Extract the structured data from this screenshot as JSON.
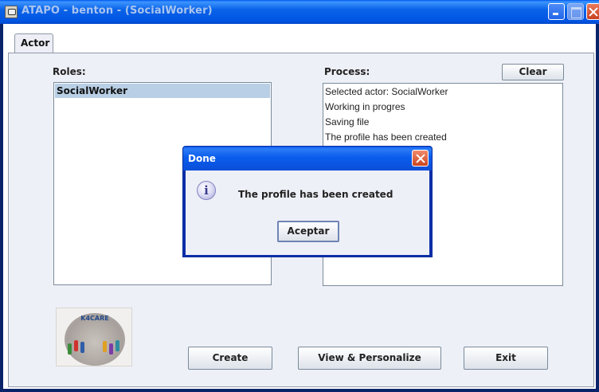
{
  "window": {
    "title": "ATAPO - benton - (SocialWorker)",
    "icon": "app-window-icon",
    "controls": [
      "minimize-icon",
      "maximize-icon",
      "close-icon"
    ]
  },
  "tabs": [
    {
      "label": "Actor",
      "selected": true
    }
  ],
  "roles": {
    "label": "Roles:",
    "items": [
      "SocialWorker"
    ],
    "selected_index": 0
  },
  "process": {
    "label": "Process:",
    "clear_label": "Clear",
    "lines": [
      "Selected actor: SocialWorker",
      "Working in progres",
      "Saving file",
      "The profile has been created"
    ]
  },
  "logo": {
    "text": "K4CARE"
  },
  "buttons": {
    "create": "Create",
    "view_personalize": "View & Personalize",
    "exit": "Exit"
  },
  "dialog": {
    "title": "Done",
    "icon": "info-icon",
    "message": "The profile has been created",
    "ok_label": "Aceptar"
  },
  "colors": {
    "titlebar": "#0054e3",
    "panel": "#eef0f7",
    "selection": "#b8cfe5",
    "close_button": "#cc4520"
  }
}
